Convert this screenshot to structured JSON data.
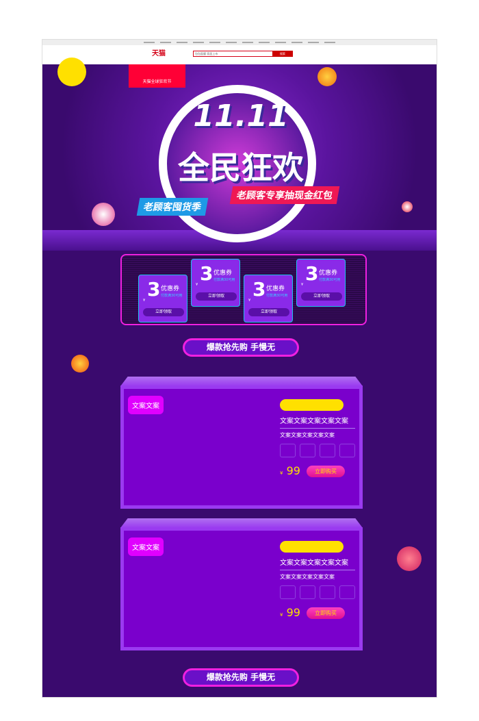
{
  "header": {
    "logo": "天猫",
    "search_placeholder": "包包面膜 家居上市",
    "search_button": "搜索"
  },
  "banner": {
    "tag": "天猫全球狂欢节",
    "title_top": "11.11",
    "title_main": "全民狂欢",
    "sub_left": "老顾客囤货季",
    "sub_right": "老顾客专享抽现金红包"
  },
  "coupons": [
    {
      "yen": "¥",
      "value": "3",
      "label": "优惠券",
      "condition": "付款满30可用",
      "action": "立即领取"
    },
    {
      "yen": "¥",
      "value": "3",
      "label": "优惠券",
      "condition": "付款满30可用",
      "action": "立即领取"
    },
    {
      "yen": "¥",
      "value": "3",
      "label": "优惠券",
      "condition": "付款满30可用",
      "action": "立即领取"
    },
    {
      "yen": "¥",
      "value": "3",
      "label": "优惠券",
      "condition": "付款满30可用",
      "action": "立即领取"
    }
  ],
  "section_title": "爆款抢先购  手慢无",
  "products": [
    {
      "tag": "文案文案",
      "title": "文案文案文案文案文案",
      "desc": "文案文案文案文案文案",
      "currency": "¥",
      "price": "99",
      "buy": "立即购买"
    },
    {
      "tag": "文案文案",
      "title": "文案文案文案文案文案",
      "desc": "文案文案文案文案文案",
      "currency": "¥",
      "price": "99",
      "buy": "立即购买"
    }
  ],
  "colors": {
    "bg": "#3a0a6e",
    "accent": "#f020e0",
    "card": "#7a00cc",
    "price": "#ffe000"
  }
}
